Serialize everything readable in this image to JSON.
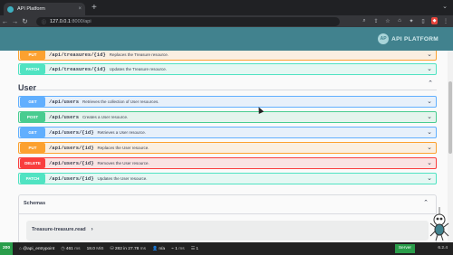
{
  "browser": {
    "tab_title": "API Platform",
    "tab_close": "×",
    "new_tab": "+",
    "window_controls": [
      "⌄"
    ],
    "url_host": "127.0.0.1",
    "url_path": ":8000/api"
  },
  "header": {
    "logo_text": "API PLATFORM",
    "logo_mark": "AP"
  },
  "treasure_ops": [
    {
      "method": "PUT",
      "path": "/api/treasures/{id}",
      "summary": "Replaces the Treasure resource."
    },
    {
      "method": "PATCH",
      "path": "/api/treasures/{id}",
      "summary": "Updates the Treasure resource."
    }
  ],
  "user_group": {
    "title": "User",
    "ops": [
      {
        "method": "GET",
        "path": "/api/users",
        "summary": "Retrieves the collection of User resources."
      },
      {
        "method": "POST",
        "path": "/api/users",
        "summary": "Creates a User resource."
      },
      {
        "method": "GET",
        "path": "/api/users/{id}",
        "summary": "Retrieves a User resource."
      },
      {
        "method": "PUT",
        "path": "/api/users/{id}",
        "summary": "Replaces the User resource."
      },
      {
        "method": "DELETE",
        "path": "/api/users/{id}",
        "summary": "Removes the User resource."
      },
      {
        "method": "PATCH",
        "path": "/api/users/{id}",
        "summary": "Updates the User resource."
      }
    ]
  },
  "schemas": {
    "title": "Schemas",
    "model": "Treasure-treasure.read"
  },
  "status_bar": {
    "code": "200",
    "route": "@api_entrypoint",
    "time": "461",
    "time_unit": "ms",
    "memory": "18.0",
    "memory_unit": "MiB",
    "cache": "282 in 27.78",
    "cache_unit": "ms",
    "security": "n/a",
    "twig": "1",
    "twig_unit": "ms",
    "logs": "1",
    "server": "Server",
    "version": "6.2.4"
  },
  "colors": {
    "header": "#41828e",
    "put": "#fca130",
    "patch": "#50e3c2",
    "get": "#61affe",
    "post": "#49cc90",
    "delete": "#f93e3e"
  }
}
